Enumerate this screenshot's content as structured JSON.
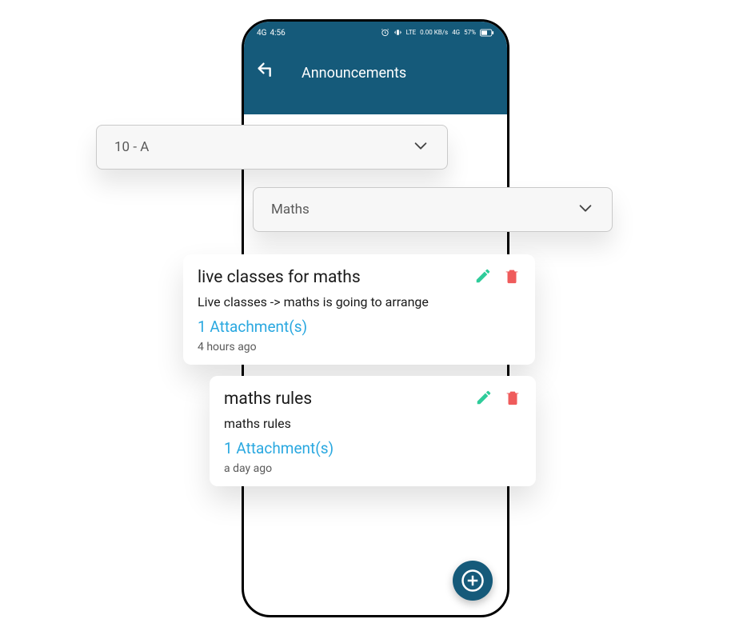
{
  "statusbar": {
    "signal": "4G",
    "time": "4:56",
    "alarm_icon": "alarm",
    "net1": "LTE",
    "net2": "0.00 KB/s",
    "net3": "4G",
    "battery": "57%"
  },
  "header": {
    "title": "Announcements"
  },
  "dropdowns": {
    "class": {
      "label": "10 - A"
    },
    "subject": {
      "label": "Maths"
    }
  },
  "announcements": [
    {
      "title": "live classes for maths",
      "body": "Live classes -> maths is going to arrange",
      "attachments": "1 Attachment(s)",
      "time": "4 hours ago"
    },
    {
      "title": "maths rules",
      "body": "maths rules",
      "attachments": "1 Attachment(s)",
      "time": "a day ago"
    }
  ],
  "icons": {
    "edit_color": "#2ecc9a",
    "delete_color": "#ef5b5b",
    "fab_fg": "#ffffff"
  }
}
